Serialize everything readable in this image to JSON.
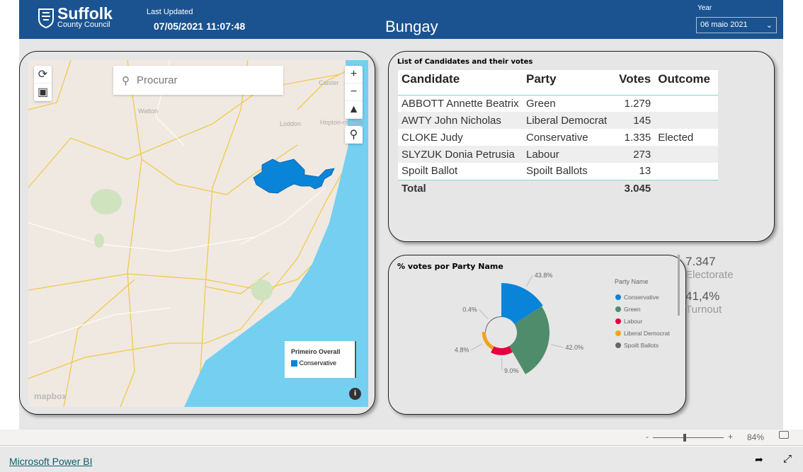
{
  "header": {
    "logo_title": "Suffolk",
    "logo_subtitle": "County Council",
    "last_updated_label": "Last Updated",
    "last_updated_value": "07/05/2021 11:07:48",
    "page_title": "Bungay",
    "year_label": "Year",
    "year_value": "06 maio 2021"
  },
  "map": {
    "search_placeholder": "Procurar",
    "place_labels": [
      "Watton",
      "Loddon",
      "Caister",
      "Hopton-on-Sea"
    ],
    "legend_title": "Primeiro Overall",
    "legend_items": [
      {
        "label": "Conservative",
        "color": "#0a84d8"
      }
    ],
    "attribution": "mapbox"
  },
  "table": {
    "title": "List of Candidates and their votes",
    "columns": [
      "Candidate",
      "Party",
      "Votes",
      "Outcome"
    ],
    "rows": [
      [
        "ABBOTT Annette Beatrix",
        "Green",
        "1.279",
        ""
      ],
      [
        "AWTY John Nicholas",
        "Liberal Democrat",
        "145",
        ""
      ],
      [
        "CLOKE Judy",
        "Conservative",
        "1.335",
        "Elected"
      ],
      [
        "SLYZUK Donia Petrusia",
        "Labour",
        "273",
        ""
      ],
      [
        "Spoilt Ballot",
        "Spoilt Ballots",
        "13",
        ""
      ]
    ],
    "total_label": "Total",
    "total_votes": "3.045"
  },
  "chart_data": {
    "type": "pie",
    "variant": "rose",
    "title": "% votes por Party Name",
    "legend_title": "Party Name",
    "legend_position": "right",
    "categories": [
      "Conservative",
      "Green",
      "Labour",
      "Liberal Democrat",
      "Spoilt Ballots"
    ],
    "values": [
      43.8,
      42.0,
      9.0,
      4.8,
      0.4
    ],
    "labels": [
      "43.8%",
      "42.0%",
      "9.0%",
      "4.8%",
      "0.4%"
    ],
    "colors": [
      "#0a84d8",
      "#4f8c6b",
      "#e3003f",
      "#f5a21b",
      "#666666"
    ]
  },
  "kpis": {
    "electorate_value": "7.347",
    "electorate_label": "Electorate",
    "turnout_value": "41,4%",
    "turnout_label": "Turnout"
  },
  "zoom": {
    "minus": "-",
    "plus": "+",
    "level": "84%",
    "level_fraction": 0.45
  },
  "footer": {
    "link": "Microsoft Power BI"
  }
}
